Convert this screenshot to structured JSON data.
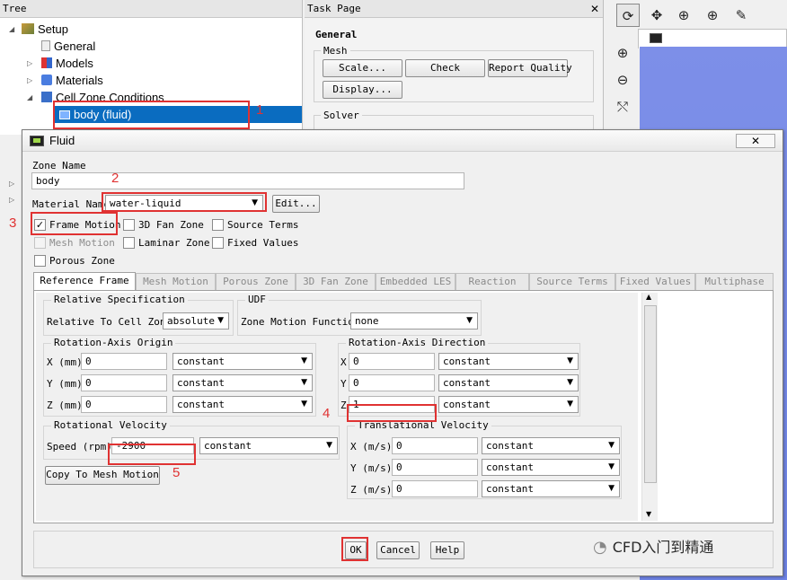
{
  "tree": {
    "header": "Tree",
    "items": [
      {
        "label": "Setup",
        "icon": "setup-icon"
      },
      {
        "label": "General",
        "icon": "general-icon"
      },
      {
        "label": "Models",
        "icon": "models-icon"
      },
      {
        "label": "Materials",
        "icon": "materials-icon"
      },
      {
        "label": "Cell Zone Conditions",
        "icon": "cell-zone-icon"
      },
      {
        "label": "body (fluid)",
        "icon": "zone-icon"
      }
    ]
  },
  "task_page": {
    "header": "Task Page",
    "title": "General",
    "mesh_group": "Mesh",
    "buttons": {
      "scale": "Scale...",
      "check": "Check",
      "report_quality": "Report Quality",
      "display": "Display..."
    },
    "solver_group": "Solver"
  },
  "dialog": {
    "title": "Fluid",
    "close_glyph": "✕",
    "zone_name_label": "Zone Name",
    "zone_name_value": "body",
    "material_label": "Material Name",
    "material_value": "water-liquid",
    "edit_button": "Edit...",
    "checkboxes": {
      "frame_motion": {
        "label": "Frame Motion",
        "checked": true
      },
      "fan_zone": {
        "label": "3D Fan Zone",
        "checked": false
      },
      "source_terms": {
        "label": "Source Terms",
        "checked": false
      },
      "mesh_motion": {
        "label": "Mesh Motion",
        "checked": false,
        "disabled": true
      },
      "laminar_zone": {
        "label": "Laminar Zone",
        "checked": false
      },
      "fixed_values": {
        "label": "Fixed Values",
        "checked": false
      },
      "porous_zone": {
        "label": "Porous Zone",
        "checked": false
      }
    },
    "check_glyph": "✓",
    "tabs": [
      "Reference Frame",
      "Mesh Motion",
      "Porous Zone",
      "3D Fan Zone",
      "Embedded LES",
      "Reaction",
      "Source Terms",
      "Fixed Values",
      "Multiphase"
    ],
    "relative_spec": {
      "title": "Relative Specification",
      "label": "Relative To Cell Zone",
      "value": "absolute"
    },
    "udf": {
      "title": "UDF",
      "label": "Zone Motion Function",
      "value": "none"
    },
    "axis_origin": {
      "title": "Rotation-Axis Origin",
      "rows": [
        {
          "label": "X (mm)",
          "value": "0",
          "mode": "constant"
        },
        {
          "label": "Y (mm)",
          "value": "0",
          "mode": "constant"
        },
        {
          "label": "Z (mm)",
          "value": "0",
          "mode": "constant"
        }
      ]
    },
    "axis_direction": {
      "title": "Rotation-Axis Direction",
      "rows": [
        {
          "label": "X",
          "value": "0",
          "mode": "constant"
        },
        {
          "label": "Y",
          "value": "0",
          "mode": "constant"
        },
        {
          "label": "Z",
          "value": "1",
          "mode": "constant"
        }
      ]
    },
    "rotational_velocity": {
      "title": "Rotational Velocity",
      "label": "Speed (rpm)",
      "value": "-2900",
      "mode": "constant"
    },
    "copy_button": "Copy To Mesh Motion",
    "translational_velocity": {
      "title": "Translational Velocity",
      "rows": [
        {
          "label": "X (m/s)",
          "value": "0",
          "mode": "constant"
        },
        {
          "label": "Y (m/s)",
          "value": "0",
          "mode": "constant"
        },
        {
          "label": "Z (m/s)",
          "value": "0",
          "mode": "constant"
        }
      ]
    },
    "buttons": {
      "ok": "OK",
      "cancel": "Cancel",
      "help": "Help"
    }
  },
  "annotations": [
    "1",
    "2",
    "3",
    "4",
    "5"
  ],
  "watermark": "CFD入门到精通",
  "colors": {
    "annotation_red": "#e03232",
    "selection_blue": "#0a6cc0",
    "graphics_blue": "#7388e6"
  }
}
